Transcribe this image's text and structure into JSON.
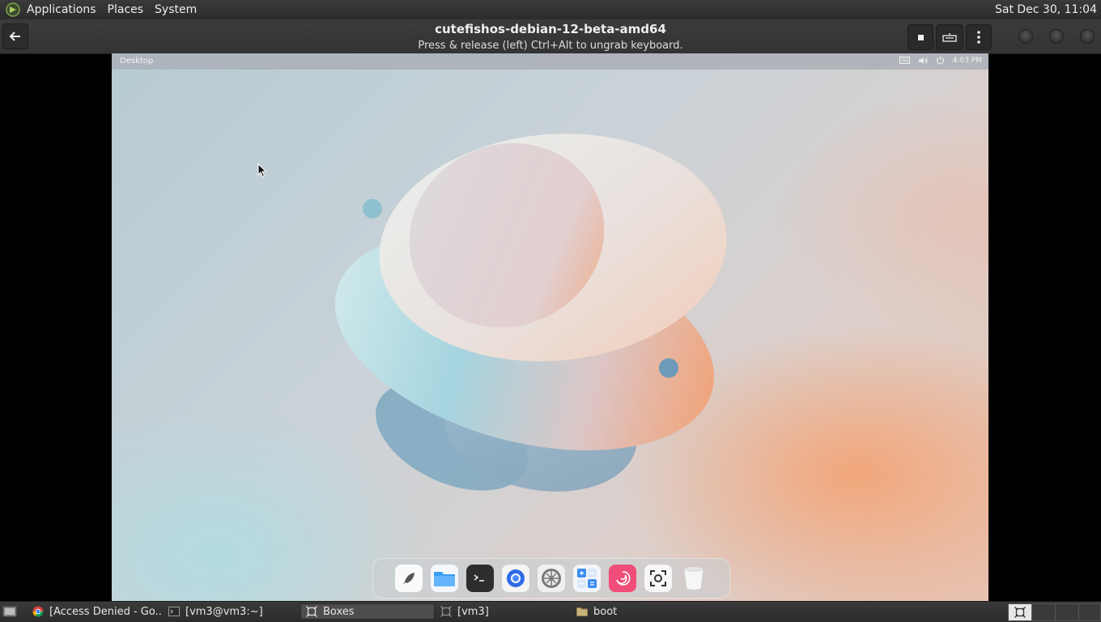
{
  "top_panel": {
    "menus": [
      "Applications",
      "Places",
      "System"
    ],
    "clock": "Sat Dec 30, 11:04"
  },
  "header": {
    "title": "cutefishos-debian-12-beta-amd64",
    "subtitle": "Press & release (left) Ctrl+Alt to ungrab keyboard.",
    "icons": [
      "back-arrow-icon",
      "stop-icon",
      "keyboard-icon",
      "kebab-menu-icon"
    ]
  },
  "vm": {
    "topbar_label": "Desktop",
    "clock": "4:03 PM",
    "tray_icons": [
      "keyboard-icon",
      "volume-icon",
      "power-icon"
    ],
    "dock_apps": [
      "launcher",
      "files",
      "terminal",
      "browser",
      "settings",
      "calculator",
      "debian",
      "screenshot",
      "trash"
    ]
  },
  "taskbar": {
    "tasks": [
      {
        "label": "[Access Denied - Go...",
        "icon": "chrome-icon"
      },
      {
        "label": "[vm3@vm3:~]",
        "icon": "terminal-icon"
      },
      {
        "label": "Boxes",
        "icon": "boxes-icon",
        "active": true
      },
      {
        "label": "[vm3]",
        "icon": "boxes-icon"
      },
      {
        "label": "boot",
        "icon": "folder-icon"
      }
    ]
  },
  "colors": {
    "panel": "#2e2e2e",
    "accent_orange": "#f39a6a",
    "accent_teal": "#9fd3dc"
  }
}
